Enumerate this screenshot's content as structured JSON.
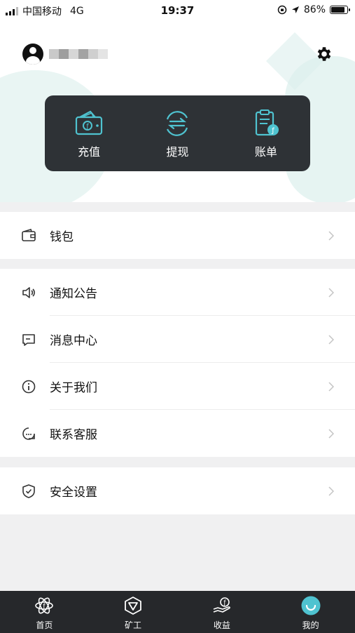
{
  "status_bar": {
    "carrier": "中国移动",
    "network": "4G",
    "time": "19:37",
    "battery_percent": "86%",
    "battery_level": 0.86
  },
  "profile": {
    "username_masked": "****"
  },
  "actions": [
    {
      "label": "充值",
      "icon": "wallet-coin-icon"
    },
    {
      "label": "提现",
      "icon": "transfer-arrows-icon"
    },
    {
      "label": "账单",
      "icon": "clipboard-bill-icon"
    }
  ],
  "menu": {
    "wallet": "钱包",
    "notice": "通知公告",
    "messages": "消息中心",
    "about": "关于我们",
    "service": "联系客服",
    "security": "安全设置"
  },
  "tabs": [
    {
      "label": "首页",
      "icon": "home-atom-icon"
    },
    {
      "label": "矿工",
      "icon": "miner-icon"
    },
    {
      "label": "收益",
      "icon": "income-icon"
    },
    {
      "label": "我的",
      "icon": "profile-smile-icon",
      "active": true
    }
  ],
  "colors": {
    "accent": "#4fc3d0",
    "card_bg": "#2e3236",
    "tabbar_bg": "#26282b",
    "page_bg": "#f0f0f1"
  }
}
